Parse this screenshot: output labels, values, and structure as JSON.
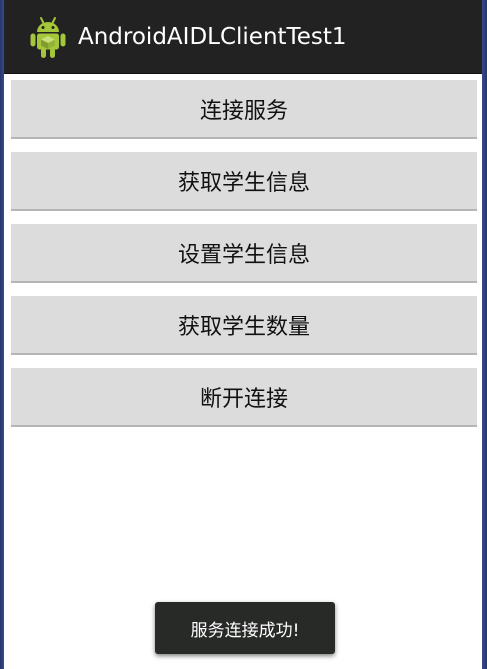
{
  "app": {
    "title": "AndroidAIDLClientTest1",
    "icon": "android-robot-icon",
    "accent": "#a4c639"
  },
  "buttons": [
    {
      "label": "连接服务"
    },
    {
      "label": "获取学生信息"
    },
    {
      "label": "设置学生信息"
    },
    {
      "label": "获取学生数量"
    },
    {
      "label": "断开连接"
    }
  ],
  "toast": {
    "message": "服务连接成功!"
  }
}
